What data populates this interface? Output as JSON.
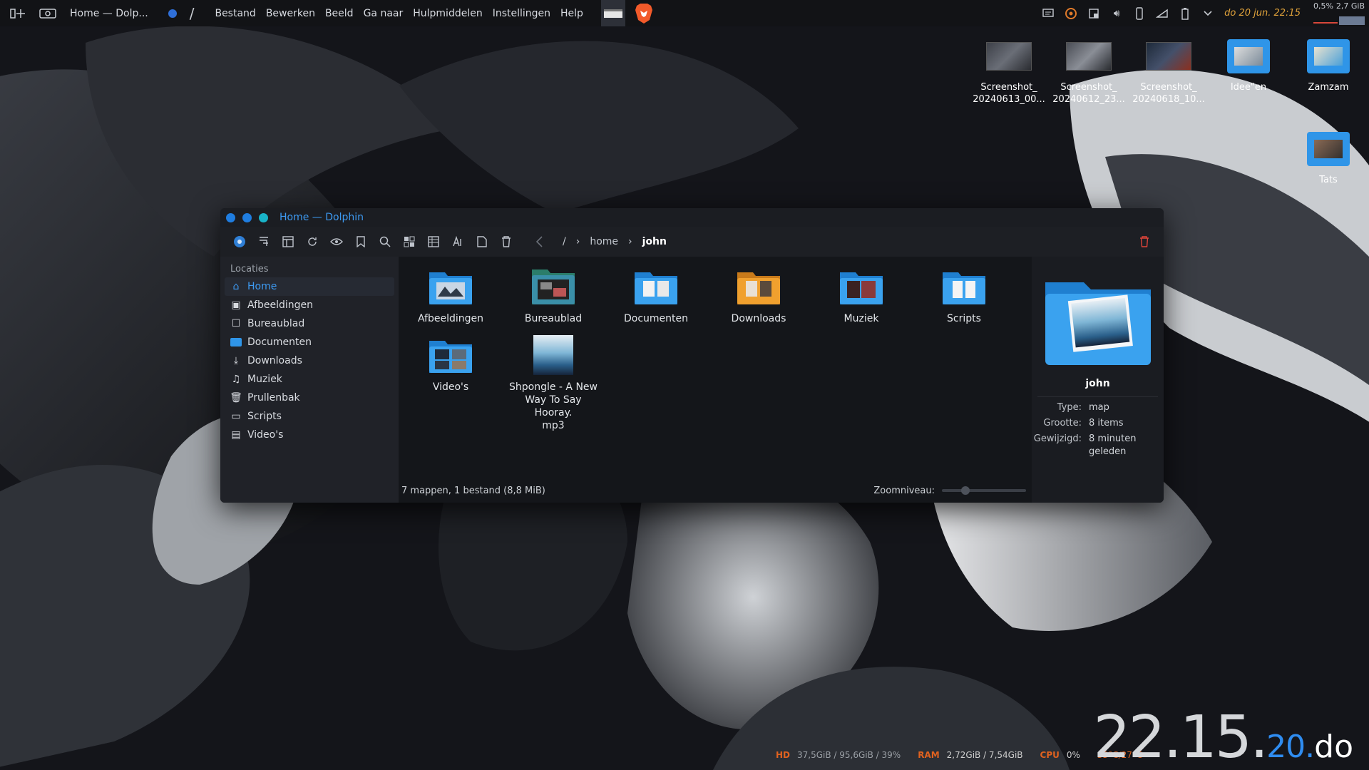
{
  "taskbar": {
    "task_title": "Home — Dolp...",
    "menus": [
      "Bestand",
      "Bewerken",
      "Beeld",
      "Ga naar",
      "Hulpmiddelen",
      "Instellingen",
      "Help"
    ],
    "date_time": "do 20 jun. 22:15",
    "cpu_pct": "0,5%",
    "mem": "2,7 GiB"
  },
  "desktop": {
    "icons": [
      {
        "line1": "Screenshot_",
        "line2": "20240613_00..."
      },
      {
        "line1": "Screenshot_",
        "line2": "20240612_23..."
      },
      {
        "line1": "Screenshot_",
        "line2": "20240618_10..."
      },
      {
        "line1": "Idee\"en",
        "line2": ""
      },
      {
        "line1": "Zamzam",
        "line2": ""
      },
      {
        "line1": "Tats",
        "line2": ""
      }
    ]
  },
  "window": {
    "title": "Home — Dolphin",
    "breadcrumb": [
      "/",
      "home",
      "john"
    ],
    "sidebar_heading": "Locaties",
    "places": [
      "Home",
      "Afbeeldingen",
      "Bureaublad",
      "Documenten",
      "Downloads",
      "Muziek",
      "Prullenbak",
      "Scripts",
      "Video's"
    ],
    "files": [
      "Afbeeldingen",
      "Bureaublad",
      "Documenten",
      "Downloads",
      "Muziek",
      "Scripts",
      "Video's"
    ],
    "music_file": {
      "line1": "Shpongle - A New",
      "line2": "Way To Say Hooray.",
      "line3": "mp3"
    },
    "status": "7 mappen, 1 bestand (8,8 MiB)",
    "zoom_label": "Zoomniveau:",
    "zoom_level": 0.25,
    "info": {
      "name": "john",
      "type_label": "Type:",
      "type": "map",
      "size_label": "Grootte:",
      "size": "8 items",
      "modified_label": "Gewijzigd:",
      "modified": "8 minuten geleden"
    }
  },
  "widgets": {
    "hd_label": "HD",
    "hd_value": "37,5GiB / 95,6GiB / 39%",
    "ram_label": "RAM",
    "ram_value": "2,72GiB / 7,54GiB",
    "cpu_label": "CPU",
    "cpu_value": "0%",
    "temp": "33°C/27°C",
    "clock_hm": "22.15.",
    "clock_sec": "20.",
    "clock_day": "do"
  }
}
